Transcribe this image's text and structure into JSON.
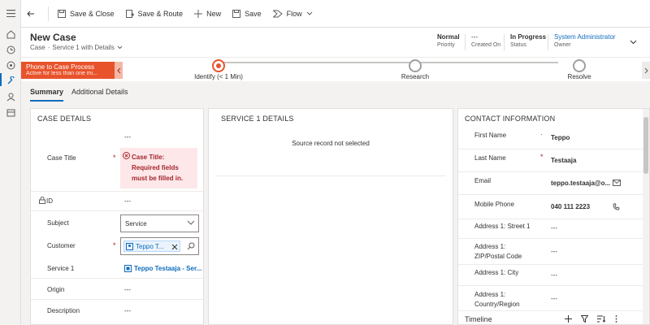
{
  "commandbar": {
    "save_close": "Save & Close",
    "save_route": "Save & Route",
    "new": "New",
    "save": "Save",
    "flow": "Flow"
  },
  "header": {
    "title": "New Case",
    "entity": "Case",
    "form": "Service 1 with Details",
    "priority_value": "Normal",
    "priority_label": "Priority",
    "created_value": "---",
    "created_label": "Created On",
    "status_value": "In Progress",
    "status_label": "Status",
    "owner_value": "System Administrator",
    "owner_label": "Owner"
  },
  "bpf": {
    "process_name": "Phone to Case Process",
    "process_sub": "Active for less than one mi...",
    "stages": [
      {
        "label": "Identify  (< 1 Min)"
      },
      {
        "label": "Research"
      },
      {
        "label": "Resolve"
      }
    ]
  },
  "tabs": [
    "Summary",
    "Additional Details"
  ],
  "case_details": {
    "title": "CASE DETAILS",
    "top_value": "---",
    "case_title_label": "Case Title",
    "case_title_error": "Case Title: Required fields must be filled in.",
    "id_label": "ID",
    "id_value": "---",
    "subject_label": "Subject",
    "subject_value": "Service",
    "customer_label": "Customer",
    "customer_value": "Teppo T...",
    "service_label": "Service 1",
    "service_value": "Teppo Testaaja - Ser...",
    "origin_label": "Origin",
    "origin_value": "---",
    "description_label": "Description",
    "description_value": "---"
  },
  "service_details": {
    "title": "SERVICE 1 DETAILS",
    "message": "Source record not selected"
  },
  "contact": {
    "title": "CONTACT INFORMATION",
    "fields": [
      {
        "label": "First Name",
        "value": "Teppo"
      },
      {
        "label": "Last Name",
        "value": "Testaaja"
      },
      {
        "label": "Email",
        "value": "teppo.testaaja@o..."
      },
      {
        "label": "Mobile Phone",
        "value": "040 111 2223"
      },
      {
        "label": "Address 1: Street 1",
        "value": "---"
      },
      {
        "label": "Address 1: ZIP/Postal Code",
        "value": "---"
      },
      {
        "label": "Address 1: City",
        "value": "---"
      },
      {
        "label": "Address 1: Country/Region",
        "value": "---"
      }
    ],
    "timeline_label": "Timeline"
  }
}
